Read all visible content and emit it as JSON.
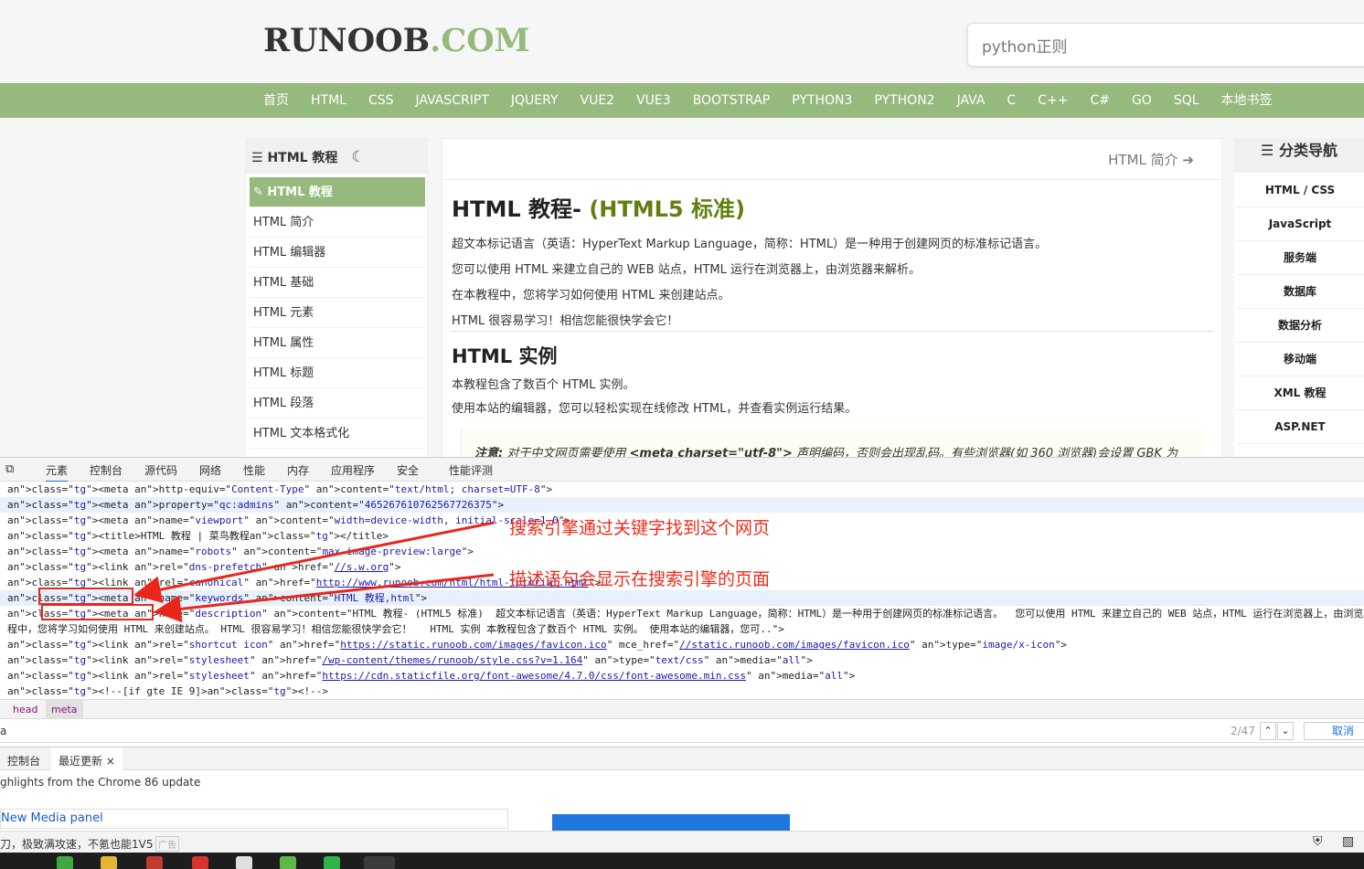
{
  "header": {
    "logo_main": "RUNOOB",
    "logo_suffix": ".COM",
    "search_value": "python正则"
  },
  "nav": {
    "items": [
      "首页",
      "HTML",
      "CSS",
      "JAVASCRIPT",
      "JQUERY",
      "VUE2",
      "VUE3",
      "BOOTSTRAP",
      "PYTHON3",
      "PYTHON2",
      "JAVA",
      "C",
      "C++",
      "C#",
      "GO",
      "SQL",
      "本地书签"
    ]
  },
  "left_sidebar": {
    "title": "HTML 教程",
    "items": [
      "HTML 教程",
      "HTML 简介",
      "HTML 编辑器",
      "HTML 基础",
      "HTML 元素",
      "HTML 属性",
      "HTML 标题",
      "HTML 段落",
      "HTML 文本格式化"
    ]
  },
  "main": {
    "next_link": "HTML 简介",
    "title": "HTML 教程-",
    "title_sub": "(HTML5 标准)",
    "paragraphs": [
      "超文本标记语言（英语：HyperText Markup Language，简称：HTML）是一种用于创建网页的标准标记语言。",
      "您可以使用 HTML 来建立自己的 WEB 站点，HTML 运行在浏览器上，由浏览器来解析。",
      "在本教程中，您将学习如何使用 HTML 来创建站点。",
      "HTML 很容易学习！相信您能很快学会它！"
    ],
    "section_title": "HTML 实例",
    "section_paragraphs": [
      "本教程包含了数百个 HTML 实例。",
      "使用本站的编辑器，您可以轻松实现在线修改 HTML，并查看实例运行结果。"
    ],
    "note_label": "注意:",
    "note_pre": "对于中文网页需要使用",
    "note_code": "<meta charset=\"utf-8\">",
    "note_post": "声明编码，否则会出现乱码。有些浏览器(如 360 浏览器)会设置 GBK 为"
  },
  "right_sidebar": {
    "title": "分类导航",
    "items": [
      "HTML / CSS",
      "JavaScript",
      "服务端",
      "数据库",
      "数据分析",
      "移动端",
      "XML 教程",
      "ASP.NET"
    ]
  },
  "devtools": {
    "tabs": [
      "元素",
      "控制台",
      "源代码",
      "网络",
      "性能",
      "内存",
      "应用程序",
      "安全",
      "性能评测"
    ],
    "breadcrumbs": [
      "head",
      "meta"
    ],
    "find_value": "a",
    "find_count": "2/47",
    "find_cancel": "取消",
    "drawer_tabs": [
      "控制台",
      "最近更新"
    ],
    "drawer_close": "×",
    "whats_new": "ghlights from the Chrome 86 update",
    "media_link": "New Media panel",
    "status_text": "刀，极致满攻速，不氪也能1V5",
    "status_tag": "广告",
    "code_lines": [
      "<meta http-equiv=\"Content-Type\" content=\"text/html; charset=UTF-8\">",
      "<meta property=\"qc:admins\" content=\"465267610762567726375\">",
      "<meta name=\"viewport\" content=\"width=device-width, initial-scale=1.0\">",
      "<title>HTML 教程 | 菜鸟教程</title>",
      "<meta name=\"robots\" content=\"max-image-preview:large\">",
      "<link rel=\"dns-prefetch\" href=\"//s.w.org\">",
      "<link rel=\"canonical\" href=\"http://www.runoob.com/html/html-tutorial.html\">",
      "<meta name=\"keywords\" content=\"HTML 教程,html\">",
      "<meta name=\"description\" content=\"HTML 教程- (HTML5 标准)  超文本标记语言（英语：HyperText Markup Language，简称：HTML）是一种用于创建网页的标准标记语言。  您可以使用 HTML 来建立自己的 WEB 站点，HTML 运行在浏览器上，由浏览器来解析。  在本教",
      "程中，您将学习如何使用 HTML 来创建站点。 HTML 很容易学习！相信您能很快学会它！   HTML 实例 本教程包含了数百个 HTML 实例。 使用本站的编辑器，您可..\">",
      "<link rel=\"shortcut icon\" href=\"https://static.runoob.com/images/favicon.ico\" mce_href=\"//static.runoob.com/images/favicon.ico\" type=\"image/x-icon\">",
      "<link rel=\"stylesheet\" href=\"/wp-content/themes/runoob/style.css?v=1.164\" type=\"text/css\" media=\"all\">",
      "<link rel=\"stylesheet\" href=\"https://cdn.staticfile.org/font-awesome/4.7.0/css/font-awesome.min.css\" media=\"all\">",
      "<!--[if gte IE 9]><!-->"
    ]
  },
  "annotations": {
    "keywords_note": "搜索引擎通过关键字找到这个网页",
    "description_note": "描述语句会显示在搜索引擎的页面"
  },
  "colors": {
    "brand_green": "#96b97d",
    "annotation_red": "#e8271a",
    "title_green": "#617f10"
  },
  "icons": [
    "list-icon",
    "moon-icon",
    "tag-icon",
    "arrow-right-icon",
    "chevron-up-icon",
    "chevron-down-icon",
    "dock-icon",
    "shield-icon",
    "image-icon"
  ]
}
